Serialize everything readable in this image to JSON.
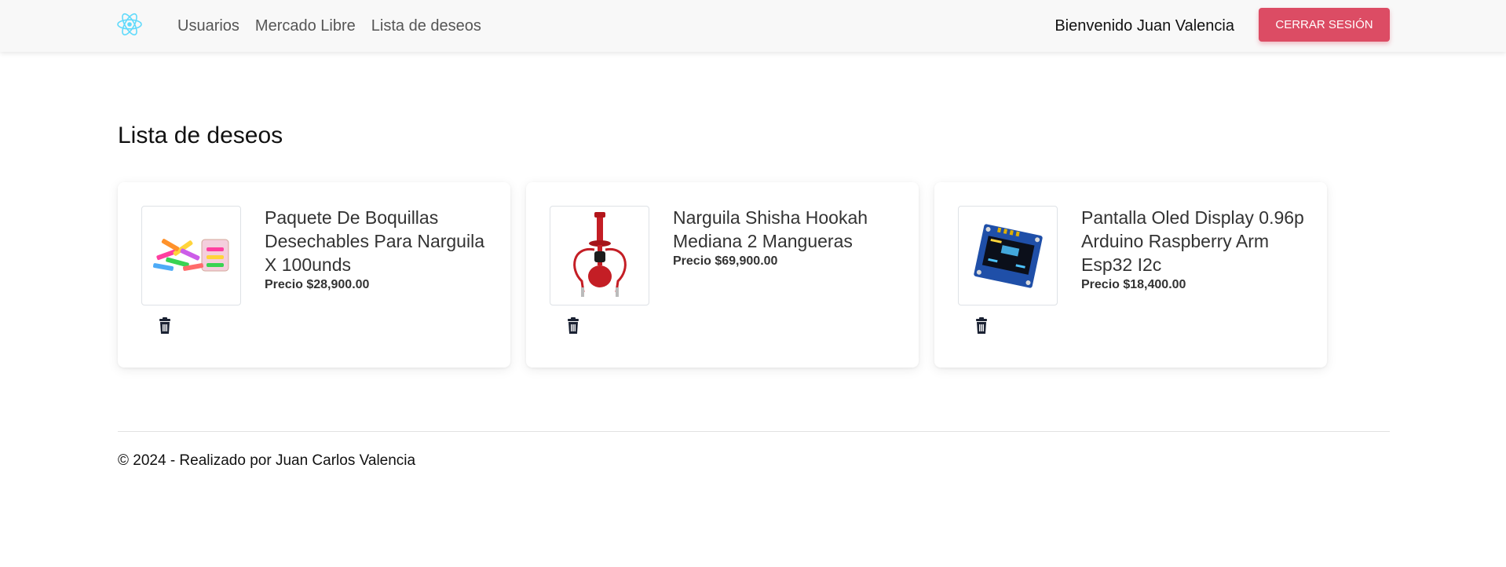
{
  "nav": {
    "logo_icon": "react-atom-icon",
    "links": [
      "Usuarios",
      "Mercado Libre",
      "Lista de deseos"
    ],
    "welcome": "Bienvenido Juan Valencia",
    "logout_label": "CERRAR SESIÓN"
  },
  "page": {
    "title": "Lista de deseos"
  },
  "wishlist": [
    {
      "title": "Paquete De Boquillas Desechables Para Narguila X 100unds",
      "price": "Precio $28,900.00",
      "image": "mouthpieces-image"
    },
    {
      "title": "Narguila Shisha Hookah Mediana 2 Mangueras",
      "price": "Precio $69,900.00",
      "image": "hookah-image"
    },
    {
      "title": "Pantalla Oled Display 0.96p Arduino Raspberry Arm Esp32 I2c",
      "price": "Precio $18,400.00",
      "image": "oled-display-image"
    }
  ],
  "footer": {
    "text": "© 2024 - Realizado por Juan Carlos Valencia"
  },
  "colors": {
    "accent": "#dc4c64",
    "react": "#61dafb"
  }
}
